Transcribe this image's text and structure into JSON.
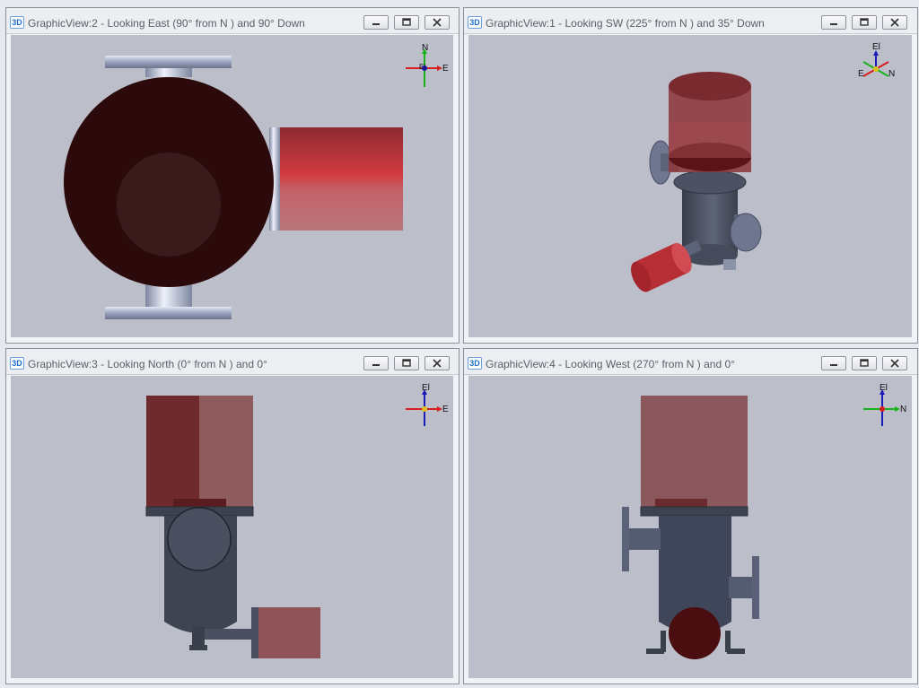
{
  "app": {
    "badge": "3D"
  },
  "panes": [
    {
      "title": "GraphicView:2 - Looking East (90° from N ) and 90° Down",
      "axes": {
        "up": "N",
        "right": "E",
        "center": "El"
      }
    },
    {
      "title": "GraphicView:1 - Looking SW (225° from N ) and 35° Down",
      "axes": {
        "up": "El",
        "right": "N",
        "left": "E"
      }
    },
    {
      "title": "GraphicView:3 - Looking North (0° from N ) and 0°",
      "axes": {
        "up": "El",
        "right": "E"
      }
    },
    {
      "title": "GraphicView:4 - Looking West (270° from N ) and 0°",
      "axes": {
        "up": "El",
        "right": "N"
      }
    }
  ],
  "colors": {
    "viewport_bg": "#bcbfca",
    "vessel_gray": "#4a5060",
    "dome_red": "#2c0a0a",
    "pipe_red": "#c23b40",
    "flange_steel": "#a9b3cc",
    "axis_red": "#d81e1e",
    "axis_green": "#19b319",
    "axis_blue": "#1a1ab8"
  },
  "window_buttons": [
    "minimize-icon",
    "maximize-icon",
    "close-icon"
  ]
}
